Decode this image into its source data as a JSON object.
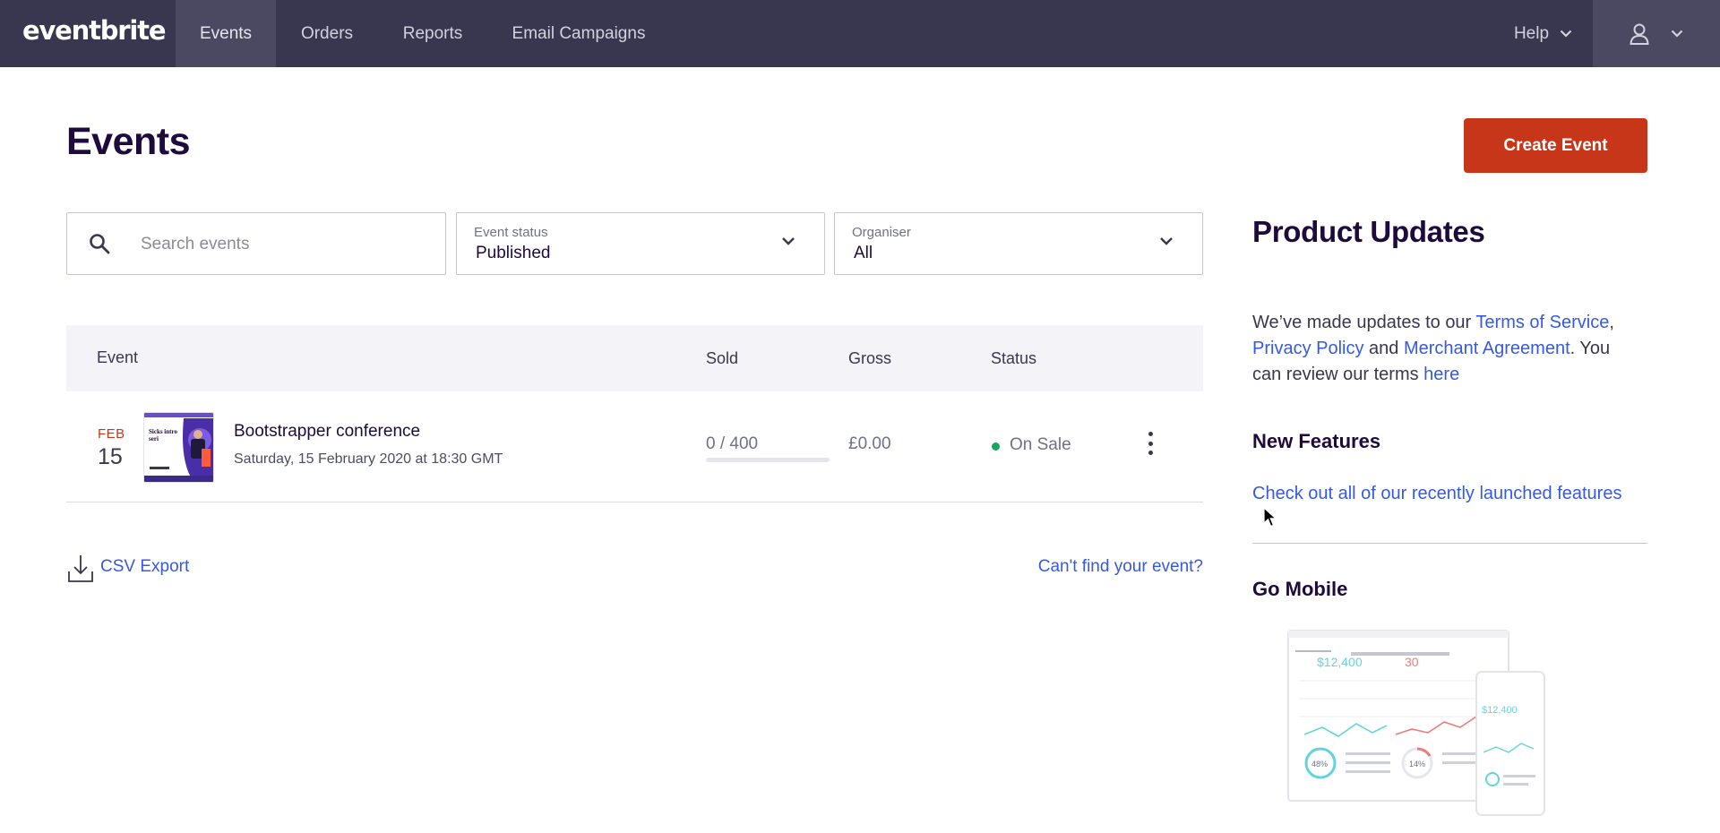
{
  "nav": {
    "logo": "eventbrite",
    "items": [
      {
        "label": "Events",
        "active": true
      },
      {
        "label": "Orders",
        "active": false
      },
      {
        "label": "Reports",
        "active": false
      },
      {
        "label": "Email Campaigns",
        "active": false
      }
    ],
    "help_label": "Help",
    "account_icon": "user-icon",
    "colors": {
      "bar": "#39364f",
      "active": "#4b4862"
    }
  },
  "page": {
    "title": "Events",
    "create_button": "Create Event",
    "accent_color": "#c8361a"
  },
  "filters": {
    "search_placeholder": "Search events",
    "search_value": "",
    "status_label": "Event status",
    "status_value": "Published",
    "organiser_label": "Organiser",
    "organiser_value": "All"
  },
  "table": {
    "columns": [
      "Event",
      "Sold",
      "Gross",
      "Status"
    ],
    "rows": [
      {
        "month": "FEB",
        "day": "15",
        "name": "Bootstrapper conference",
        "date": "Saturday, 15 February 2020 at 18:30 GMT",
        "sold": "0 / 400",
        "sold_fraction": 0,
        "gross": "£0.00",
        "status": "On Sale",
        "status_color": "#14a85a",
        "thumbnail_text": "Sicks intro seri"
      }
    ]
  },
  "footer": {
    "csv_export": "CSV Export",
    "cant_find": "Can't find your event?"
  },
  "sidebar": {
    "title": "Product Updates",
    "updates_prefix": "We’ve made updates to our ",
    "terms_link": "Terms of Service",
    "comma": ",",
    "privacy_link": "Privacy Policy",
    "and_text": " and ",
    "merchant_link": "Merchant Agreement",
    "review_text": ". You can review our terms ",
    "here_link": "here",
    "new_features_title": "New Features",
    "new_features_link": "Check out all of our recently launched features",
    "go_mobile_title": "Go Mobile",
    "mobile_preview": {
      "amount": "$12,400",
      "count": "30",
      "pct_a": "48%",
      "pct_b": "14%",
      "phone_amount": "$12,400"
    }
  }
}
